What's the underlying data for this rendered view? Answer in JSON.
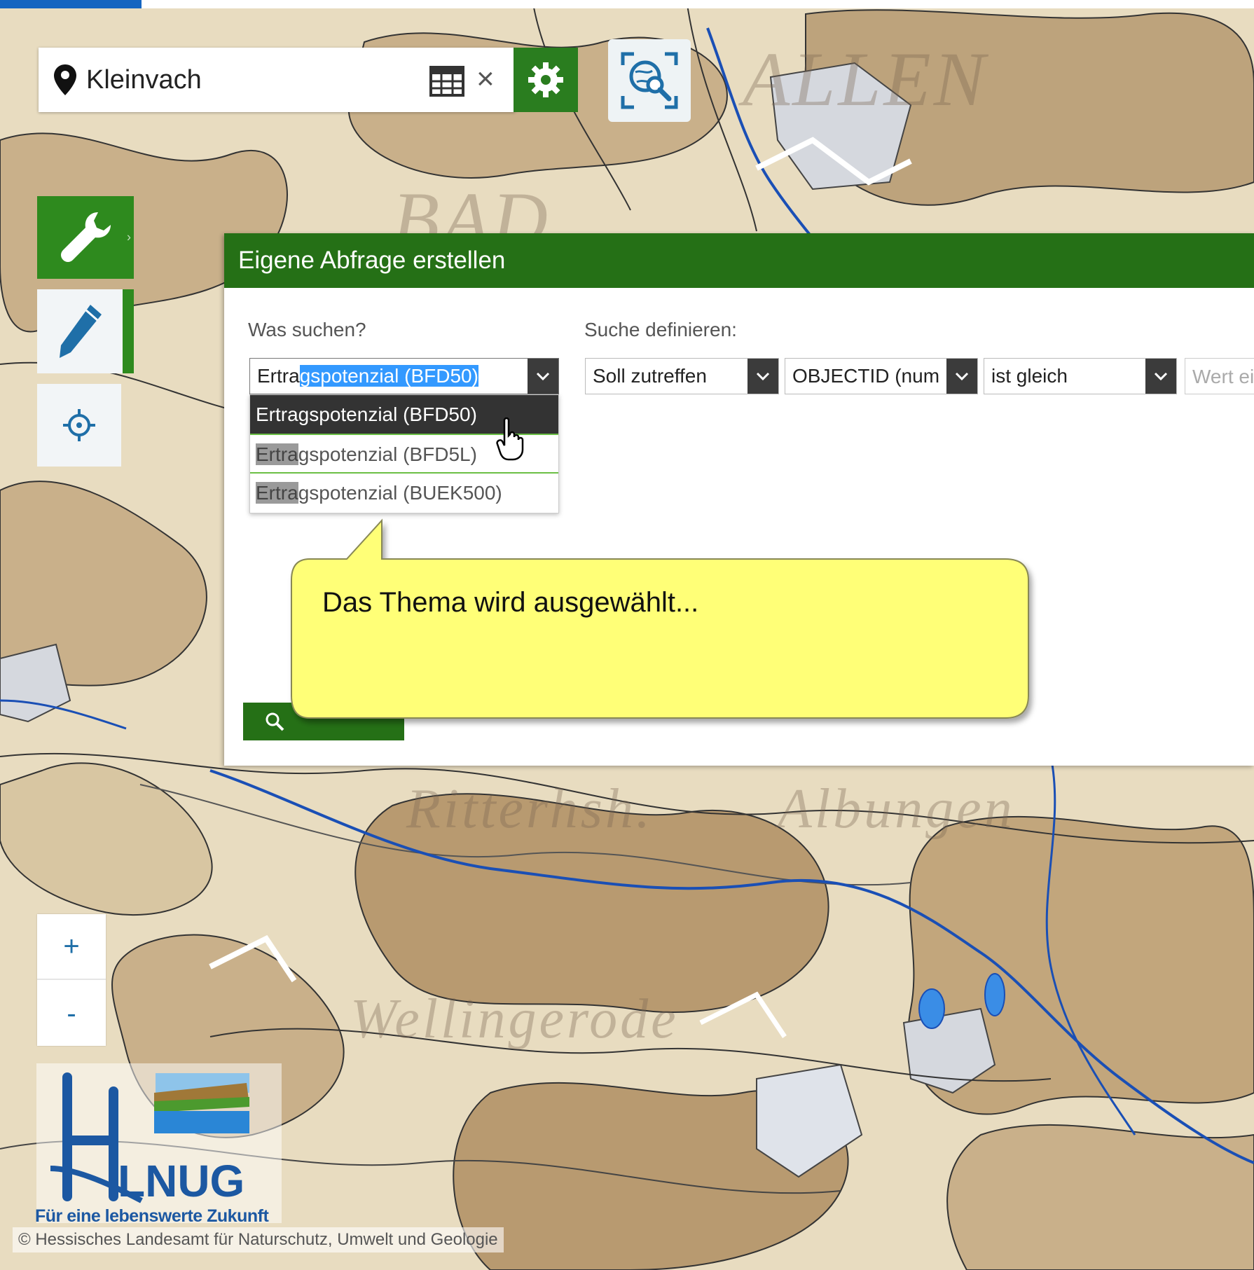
{
  "search": {
    "value": "Kleinvach"
  },
  "icons": {
    "location": "map-pin-icon",
    "table": "table-icon",
    "clear": "close-icon",
    "settings": "gear-icon",
    "map_search": "globe-search-icon",
    "wrench": "wrench-icon",
    "pencil": "pencil-icon",
    "locate": "crosshair-icon",
    "search_button": "magnifier-icon"
  },
  "clear_glyph": "×",
  "toolbar": {
    "chevron": "›"
  },
  "zoom": {
    "in_label": "+",
    "out_label": "-"
  },
  "dialog": {
    "title": "Eigene Abfrage erstellen",
    "what_label": "Was suchen?",
    "define_label": "Suche definieren:",
    "theme_select": {
      "value_prefix": "Ertra",
      "value_selected": "gspotenzial (BFD50)"
    },
    "condition_select": "Soll zutreffen",
    "field_select": "OBJECTID (num",
    "operator_select": "ist gleich",
    "value_placeholder": "Wert ei",
    "dropdown": [
      {
        "match": "",
        "rest": "Ertragspotenzial (BFD50)",
        "active": true
      },
      {
        "match": "Ertra",
        "rest": "gspotenzial (BFD5L)",
        "active": false
      },
      {
        "match": "Ertra",
        "rest": "gspotenzial (BUEK500)",
        "active": false
      }
    ]
  },
  "callout": {
    "text": "Das Thema wird ausgewählt..."
  },
  "logo": {
    "slogan": "Für eine lebenswerte Zukunft"
  },
  "copyright": "© Hessisches Landesamt für Naturschutz, Umwelt und Geologie",
  "colors": {
    "header_green": "#257016",
    "tool_green": "#2e8a1e",
    "callout_yellow": "#ffff77",
    "map_base": "#e8dcc0",
    "map_brown": "#c9b08a",
    "accent_blue": "#1565c0"
  }
}
